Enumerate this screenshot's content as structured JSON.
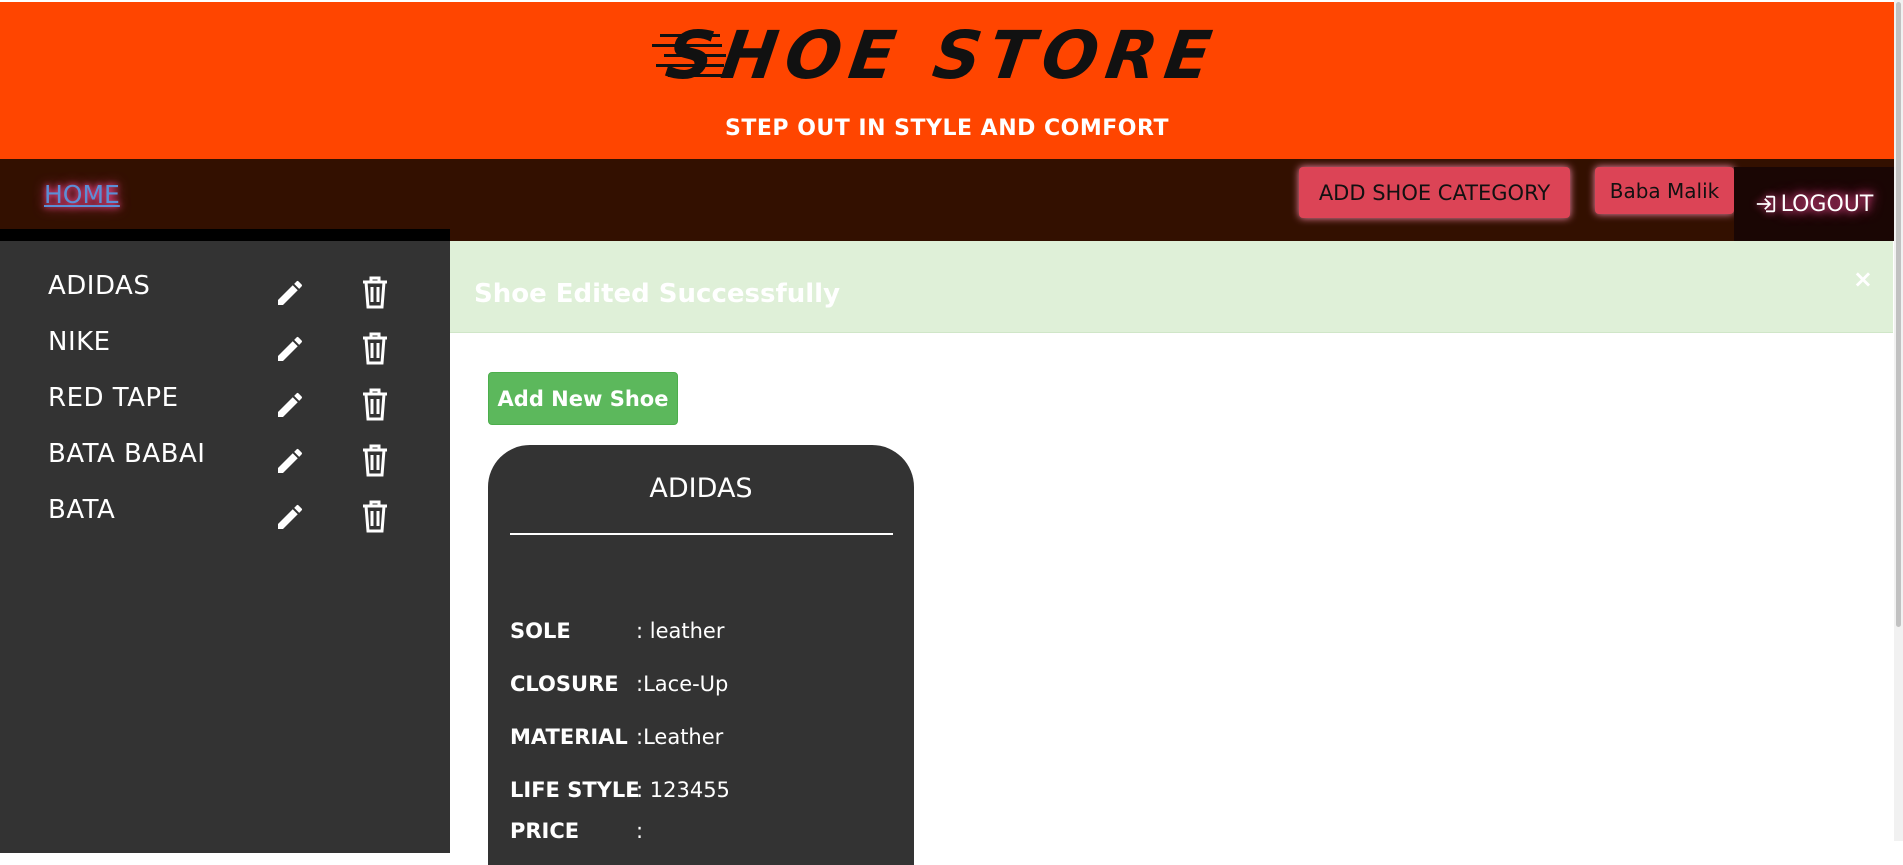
{
  "header": {
    "logo_text": "SHOE STORE",
    "tagline": "STEP OUT IN STYLE AND COMFORT"
  },
  "navbar": {
    "home_label": "HOME",
    "add_category_label": "ADD SHOE CATEGORY",
    "user_label": "Baba Malik",
    "logout_label": "LOGOUT"
  },
  "sidebar": {
    "categories": [
      {
        "name": "ADIDAS"
      },
      {
        "name": "NIKE"
      },
      {
        "name": "RED TAPE"
      },
      {
        "name": "BATA BABAI"
      },
      {
        "name": "BATA"
      }
    ]
  },
  "alert": {
    "message": "Shoe Edited Successfully",
    "close_symbol": "×"
  },
  "main": {
    "add_shoe_label": "Add New Shoe",
    "card": {
      "title": "ADIDAS",
      "specs": [
        {
          "label": "SOLE",
          "value": ": leather"
        },
        {
          "label": "CLOSURE",
          "value": ":Lace-Up"
        },
        {
          "label": "MATERIAL",
          "value": ":Leather"
        },
        {
          "label": "LIFE STYLE",
          "value": ": 123455"
        },
        {
          "label": "PRICE",
          "value": ":"
        }
      ]
    }
  },
  "colors": {
    "header_bg": "#ff4500",
    "navbar_bg": "#331000",
    "button_pink": "#dc4456",
    "sidebar_bg": "#333333",
    "alert_bg": "#dff0d8",
    "success_green": "#5cb85c"
  }
}
